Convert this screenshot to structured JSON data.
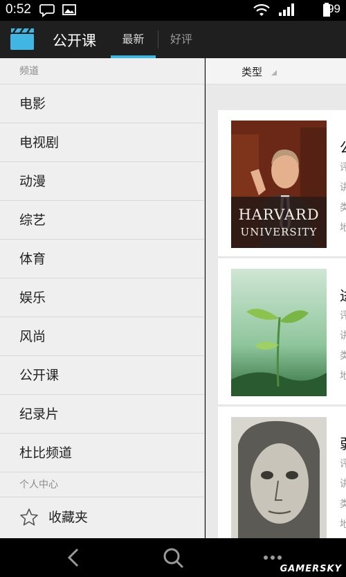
{
  "status_bar": {
    "time": "0:52",
    "battery": "99",
    "icons": [
      "chat-bubble-icon",
      "image-icon",
      "wifi-icon",
      "signal-icon"
    ]
  },
  "action_bar": {
    "app_title": "公开课",
    "tabs": [
      {
        "label": "最新",
        "selected": true
      },
      {
        "label": "好评",
        "selected": false
      }
    ],
    "accent_color": "#3fb6e3"
  },
  "drawer": {
    "channels_header": "频道",
    "channels": [
      "电影",
      "电视剧",
      "动漫",
      "综艺",
      "体育",
      "娱乐",
      "风尚",
      "公开课",
      "纪录片",
      "杜比频道"
    ],
    "personal_header": "个人中心",
    "favorites_label": "收藏夹"
  },
  "content": {
    "filter_label": "类型",
    "cards": [
      {
        "title_fragment": "公",
        "line_fragments": [
          "评",
          "讲",
          "类",
          "地"
        ],
        "thumb_text": [
          "HARVARD",
          "UNIVERSITY"
        ]
      },
      {
        "title_fragment": "进",
        "line_fragments": [
          "评",
          "讲",
          "类",
          "地"
        ]
      },
      {
        "title_fragment": "弱",
        "line_fragments": [
          "评",
          "讲",
          "类",
          "地"
        ]
      }
    ]
  },
  "nav_bar": {
    "buttons": [
      "back-icon",
      "search-icon",
      "more-icon"
    ]
  },
  "watermark": "GAMERSKY"
}
